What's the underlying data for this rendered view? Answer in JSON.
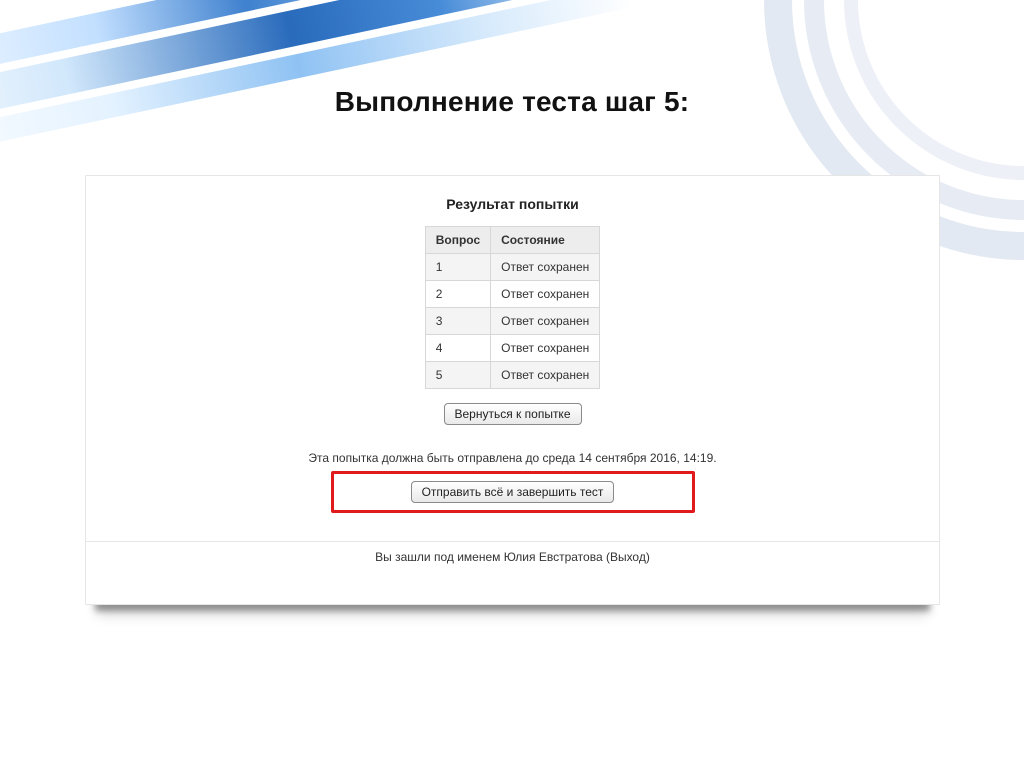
{
  "header": {
    "title": "Выполнение  теста шаг 5:"
  },
  "panel": {
    "title": "Результат попытки",
    "table": {
      "headers": [
        "Вопрос",
        "Состояние"
      ],
      "rows": [
        {
          "q": "1",
          "status": "Ответ сохранен"
        },
        {
          "q": "2",
          "status": "Ответ сохранен"
        },
        {
          "q": "3",
          "status": "Ответ сохранен"
        },
        {
          "q": "4",
          "status": "Ответ сохранен"
        },
        {
          "q": "5",
          "status": "Ответ сохранен"
        }
      ]
    },
    "return_button": "Вернуться к попытке",
    "deadline": "Эта попытка должна быть отправлена до среда 14 сентября 2016, 14:19.",
    "submit_button": "Отправить всё и завершить тест",
    "footer": "Вы зашли под именем Юлия Евстратова (Выход)"
  }
}
